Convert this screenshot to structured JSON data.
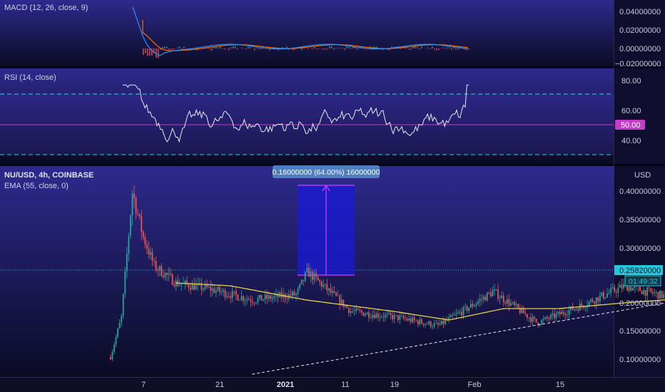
{
  "colors": {
    "bg_top": "#2e2a8e",
    "bg_bottom": "#0b0b24",
    "candle_up": "#26a69a",
    "candle_down": "#ef5350",
    "ema": "#e5d24a",
    "rsi_line": "#e8e8f0",
    "rsi_band": "#31d5e6",
    "rsi_mid": "#c23cc9",
    "macd_line": "#2f8df0",
    "signal_line": "#ff6d00",
    "measure_fill": "#1a1ad8",
    "measure_line": "#d23cff",
    "price_label_bg": "#26c6da",
    "measure_label_bg": "#4f7fc0",
    "rsi_label_bg": "#c23cc9"
  },
  "macd_panel": {
    "title": "MACD (12, 26, close, 9)",
    "axis_labels": [
      "0.04000000",
      "0.02000000",
      "0.00000000",
      "−0.02000000"
    ]
  },
  "rsi_panel": {
    "title": "RSI (14, close)",
    "axis_labels": [
      "80.00",
      "60.00",
      "40.00"
    ],
    "current_label": "50.00"
  },
  "price_panel": {
    "title": "NU/USD, 4h, COINBASE",
    "ema_title": "EMA (55, close, 0)",
    "currency": "USD",
    "axis_labels": [
      "0.40000000",
      "0.35000000",
      "0.30000000",
      "0.25820000",
      "0.20000000",
      "0.15000000",
      "0.10000000"
    ],
    "current_price": "0.25820000",
    "countdown": "01:49:32",
    "measure_label": "0.16000000 (64.00%) 16000000"
  },
  "x_axis": {
    "labels": [
      "7",
      "21",
      "2021",
      "11",
      "19",
      "Feb",
      "15"
    ]
  },
  "chart_data": {
    "type": "candlestick",
    "title": "NU/USD, 4h, COINBASE",
    "timeframe": "4h",
    "x_ticks": [
      "7",
      "21",
      "2021",
      "11",
      "19",
      "Feb",
      "15"
    ],
    "ylim": [
      0.08,
      0.42
    ],
    "last_price": 0.2582,
    "price_path": [
      {
        "date": "Dec 3",
        "price": 0.11
      },
      {
        "date": "Dec 4",
        "price": 0.18
      },
      {
        "date": "Dec 5",
        "price": 0.4
      },
      {
        "date": "Dec 6",
        "price": 0.32
      },
      {
        "date": "Dec 7",
        "price": 0.27
      },
      {
        "date": "Dec 9",
        "price": 0.24
      },
      {
        "date": "Dec 12",
        "price": 0.23
      },
      {
        "date": "Dec 16",
        "price": 0.21
      },
      {
        "date": "Dec 20",
        "price": 0.22
      },
      {
        "date": "Dec 21",
        "price": 0.26
      },
      {
        "date": "Dec 25",
        "price": 0.19
      },
      {
        "date": "Dec 29",
        "price": 0.18
      },
      {
        "date": "Jan 2",
        "price": 0.165
      },
      {
        "date": "Jan 5",
        "price": 0.2
      },
      {
        "date": "Jan 7",
        "price": 0.225
      },
      {
        "date": "Jan 11",
        "price": 0.17
      },
      {
        "date": "Jan 15",
        "price": 0.2
      },
      {
        "date": "Jan 19",
        "price": 0.235
      },
      {
        "date": "Jan 23",
        "price": 0.215
      },
      {
        "date": "Jan 27",
        "price": 0.225
      },
      {
        "date": "Jan 31",
        "price": 0.2582
      }
    ],
    "ema_55": [
      {
        "date": "Dec 9",
        "value": 0.24
      },
      {
        "date": "Dec 14",
        "value": 0.235
      },
      {
        "date": "Dec 21",
        "value": 0.21
      },
      {
        "date": "Dec 29",
        "value": 0.19
      },
      {
        "date": "Jan 3",
        "value": 0.175
      },
      {
        "date": "Jan 8",
        "value": 0.195
      },
      {
        "date": "Jan 13",
        "value": 0.195
      },
      {
        "date": "Jan 19",
        "value": 0.205
      },
      {
        "date": "Jan 26",
        "value": 0.215
      },
      {
        "date": "Jan 31",
        "value": 0.22
      }
    ],
    "trendline": [
      {
        "date": "Dec 16",
        "price": 0.08
      },
      {
        "date": "Feb 19",
        "price": 0.295
      }
    ],
    "measure": {
      "from_price": 0.25,
      "to_price": 0.41,
      "change": 0.16,
      "percent": 64.0
    },
    "rsi": {
      "levels": [
        30,
        50,
        70
      ],
      "ylim": [
        28,
        82
      ],
      "last": 76
    },
    "macd": {
      "ylim": [
        -0.02,
        0.045
      ]
    }
  }
}
